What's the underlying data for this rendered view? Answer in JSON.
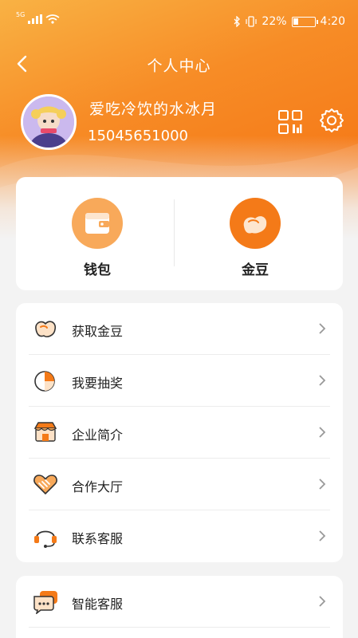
{
  "status_bar": {
    "network": "5G",
    "battery_percent": "22%",
    "battery_level": 0.22,
    "time": "4:20"
  },
  "nav": {
    "title": "个人中心"
  },
  "profile": {
    "username": "爱吃冷饮的水冰月",
    "phone": "15045651000"
  },
  "wallet": {
    "items": [
      {
        "label": "钱包",
        "icon": "wallet-icon"
      },
      {
        "label": "金豆",
        "icon": "bean-icon"
      }
    ]
  },
  "menu": {
    "items": [
      {
        "label": "获取金豆",
        "icon": "bean-outline-icon"
      },
      {
        "label": "我要抽奖",
        "icon": "pie-chart-icon"
      },
      {
        "label": "企业简介",
        "icon": "shop-icon"
      },
      {
        "label": "合作大厅",
        "icon": "handshake-heart-icon"
      },
      {
        "label": "联系客服",
        "icon": "headset-icon"
      }
    ],
    "items2": [
      {
        "label": "智能客服",
        "icon": "chat-bubble-icon"
      }
    ]
  },
  "colors": {
    "brand": "#f47a18",
    "accent_light": "#f9b244",
    "icon_fill": "#f8a95a"
  }
}
